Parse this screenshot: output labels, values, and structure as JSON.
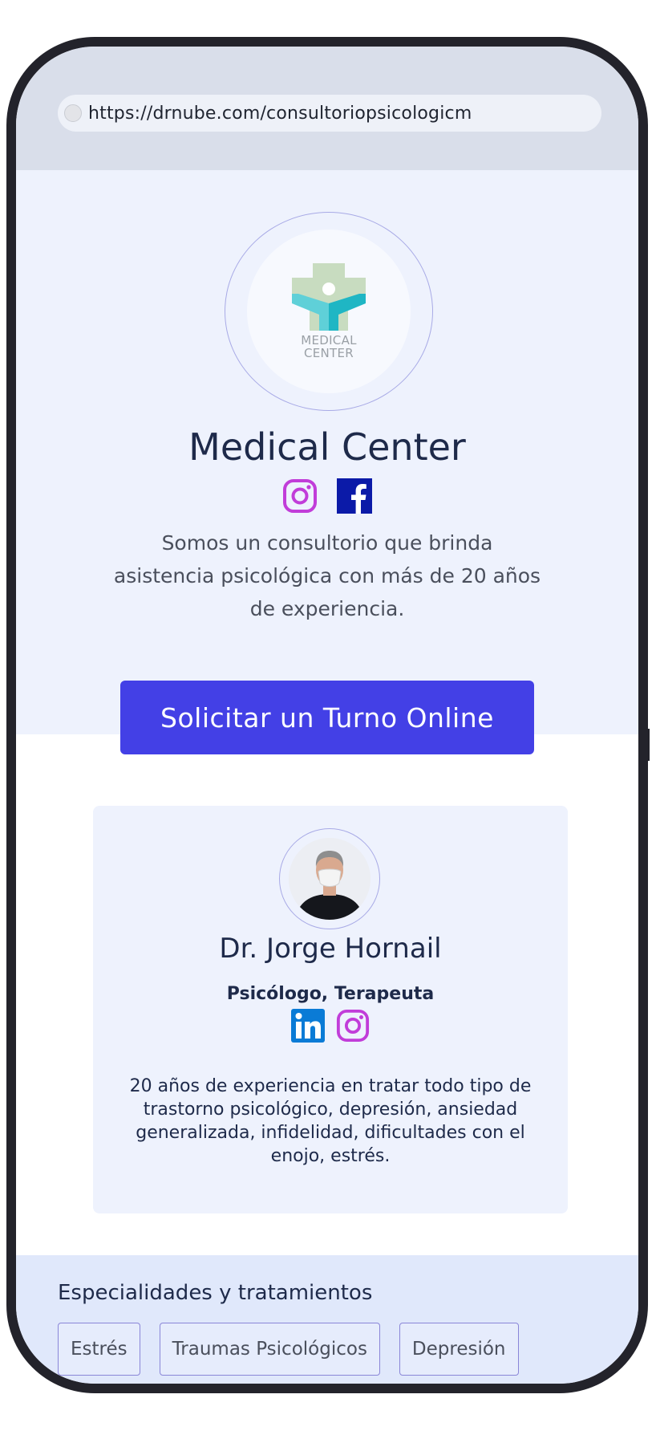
{
  "browser": {
    "url": "https://drnube.com/consultoriopsicologicm"
  },
  "hero": {
    "logo_text_line1": "MEDICAL",
    "logo_text_line2": "CENTER",
    "title": "Medical Center",
    "social": [
      "instagram-icon",
      "facebook-icon"
    ],
    "description": "Somos un consultorio que brinda asistencia psicológica con más de 20 años de experiencia.",
    "cta_label": "Solicitar un Turno Online"
  },
  "doctor": {
    "name": "Dr. Jorge Hornail",
    "role": "Psicólogo, Terapeuta",
    "social": [
      "linkedin-icon",
      "instagram-icon"
    ],
    "description": "20 años de experiencia en tratar todo tipo de trastorno psicológico, depresión, ansiedad generalizada, infidelidad, dificultades con el enojo, estrés."
  },
  "specialties": {
    "title": "Especialidades y tratamientos",
    "tags": [
      "Estrés",
      "Traumas Psicológicos",
      "Depresión"
    ]
  },
  "colors": {
    "accent": "#4340e6",
    "hero_bg": "#eef2fd",
    "instagram": "#c13dd9",
    "facebook": "#0b1aa8",
    "linkedin": "#0a7bd6"
  }
}
